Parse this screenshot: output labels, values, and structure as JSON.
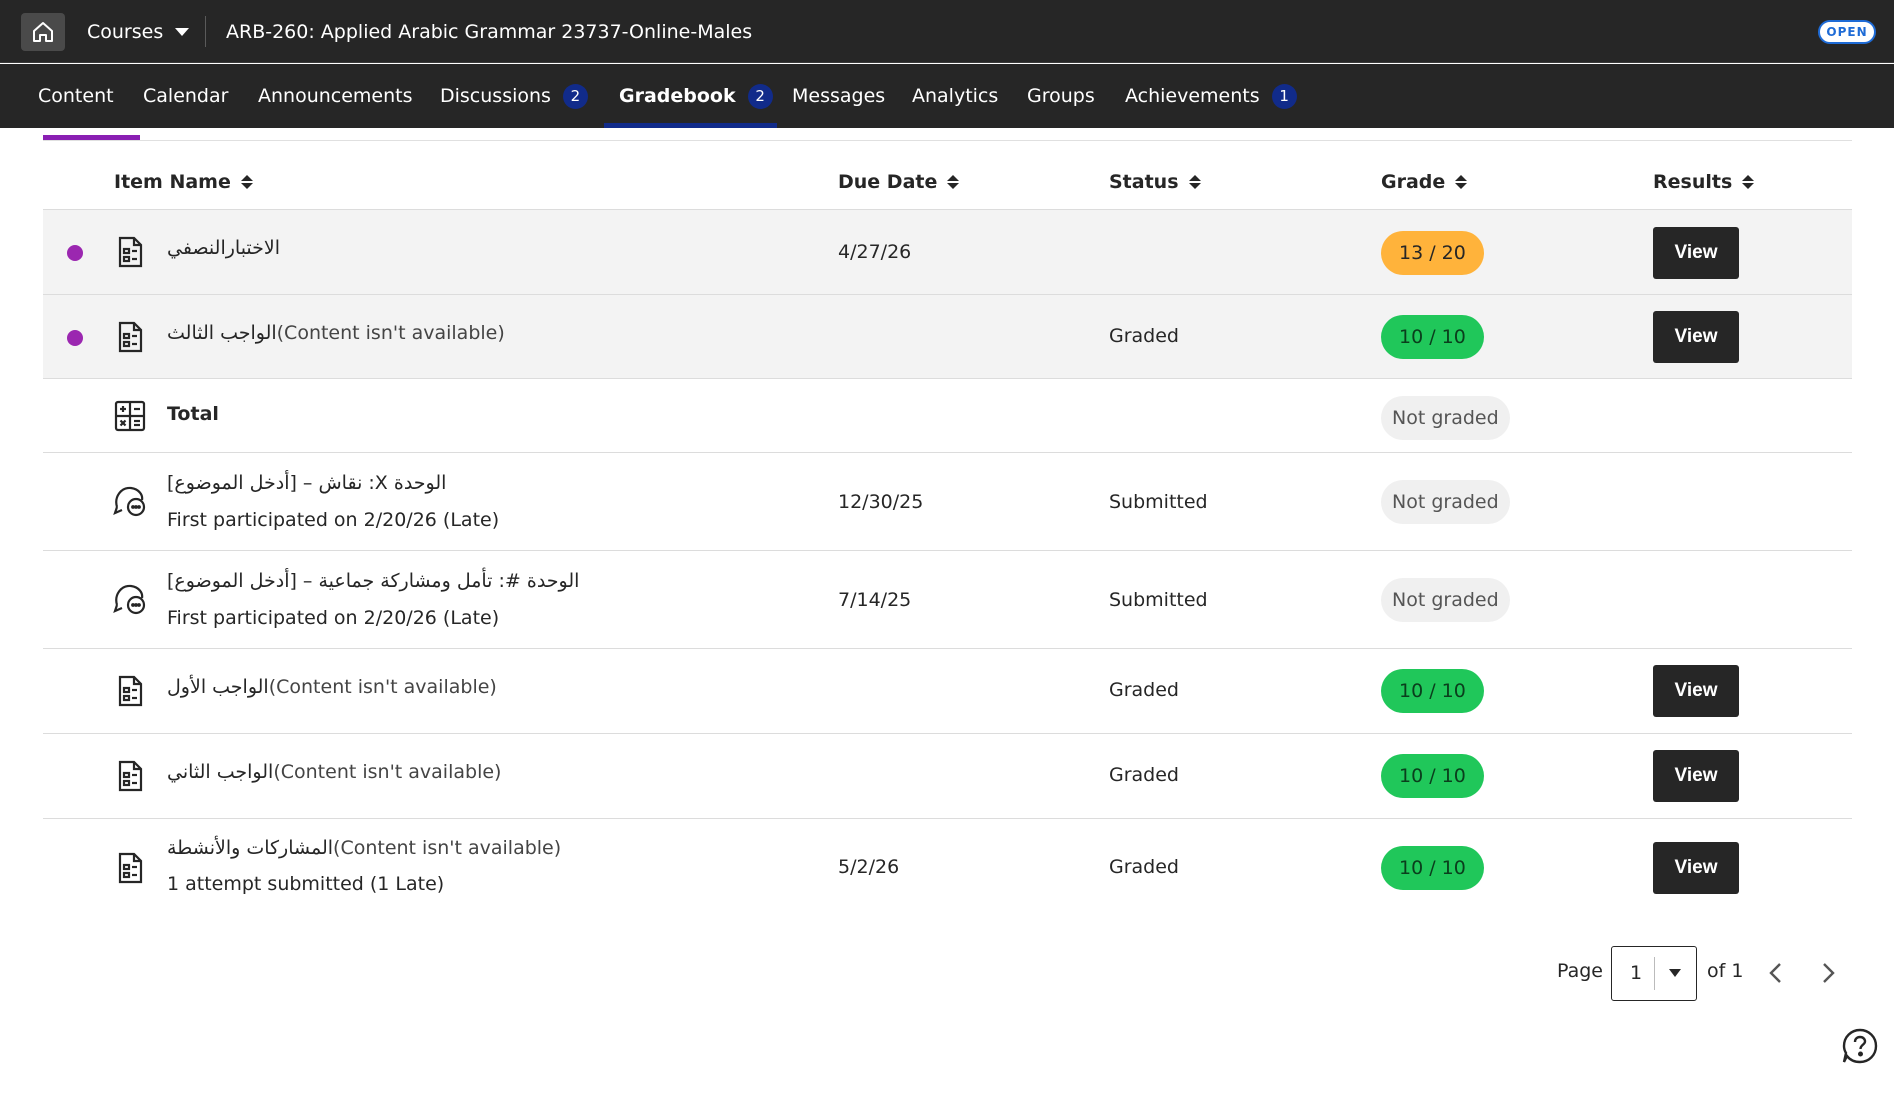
{
  "header": {
    "courses_label": "Courses",
    "course_title": "ARB-260: Applied Arabic Grammar 23737-Online-Males",
    "open_badge": "OPEN"
  },
  "nav": {
    "tabs": [
      {
        "label": "Content"
      },
      {
        "label": "Calendar"
      },
      {
        "label": "Announcements"
      },
      {
        "label": "Discussions",
        "badge": "2"
      },
      {
        "label": "Gradebook",
        "badge": "2",
        "active": true
      },
      {
        "label": "Messages"
      },
      {
        "label": "Analytics"
      },
      {
        "label": "Groups"
      },
      {
        "label": "Achievements",
        "badge": "1"
      }
    ]
  },
  "table": {
    "columns": [
      "Item Name",
      "Due Date",
      "Status",
      "Grade",
      "Results"
    ],
    "rows": [
      {
        "icon": "document-icon",
        "unread": true,
        "name": "الاختبارالنصفي",
        "unavailable": "",
        "sub": "",
        "due": "4/27/26",
        "status": "",
        "grade": "13 / 20",
        "grade_style": "orange",
        "results": "View"
      },
      {
        "icon": "document-icon",
        "unread": true,
        "name": "الواجب الثالث",
        "unavailable": "(Content isn't available)",
        "sub": "",
        "due": "",
        "status": "Graded",
        "grade": "10 / 10",
        "grade_style": "green",
        "results": "View"
      },
      {
        "icon": "calculator-icon",
        "unread": false,
        "name": "Total",
        "unavailable": "",
        "sub": "",
        "due": "",
        "status": "",
        "grade": "Not graded",
        "grade_style": "gray",
        "results": ""
      },
      {
        "icon": "discussion-icon",
        "unread": false,
        "name": "نقاش – [أدخل الموضوع] :X الوحدة",
        "unavailable": "",
        "sub": "First participated on 2/20/26 (Late)",
        "due": "12/30/25",
        "status": "Submitted",
        "grade": "Not graded",
        "grade_style": "gray",
        "results": ""
      },
      {
        "icon": "discussion-icon",
        "unread": false,
        "name": "الوحدة #: تأمل ومشاركة جماعية – [أدخل الموضوع]",
        "unavailable": "",
        "sub": "First participated on 2/20/26 (Late)",
        "due": "7/14/25",
        "status": "Submitted",
        "grade": "Not graded",
        "grade_style": "gray",
        "results": ""
      },
      {
        "icon": "document-icon",
        "unread": false,
        "name": "الواجب الأول",
        "unavailable": "(Content isn't available)",
        "sub": "",
        "due": "",
        "status": "Graded",
        "grade": "10 / 10",
        "grade_style": "green",
        "results": "View"
      },
      {
        "icon": "document-icon",
        "unread": false,
        "name": "الواجب الثاني",
        "unavailable": "(Content isn't available)",
        "sub": "",
        "due": "",
        "status": "Graded",
        "grade": "10 / 10",
        "grade_style": "green",
        "results": "View"
      },
      {
        "icon": "document-icon",
        "unread": false,
        "name": "المشاركات والأنشطة",
        "unavailable": "(Content isn't available)",
        "sub": "1 attempt submitted (1 Late)",
        "due": "5/2/26",
        "status": "Graded",
        "grade": "10 / 10",
        "grade_style": "green",
        "results": "View"
      }
    ]
  },
  "pagination": {
    "page_label": "Page",
    "current_page": "1",
    "of_label": "of 1"
  },
  "colors": {
    "topbar": "#262626",
    "accent_purple": "#8a1fb3",
    "badge_blue": "#112b8a",
    "grade_green": "#20c75a",
    "grade_orange": "#ffb33b"
  }
}
